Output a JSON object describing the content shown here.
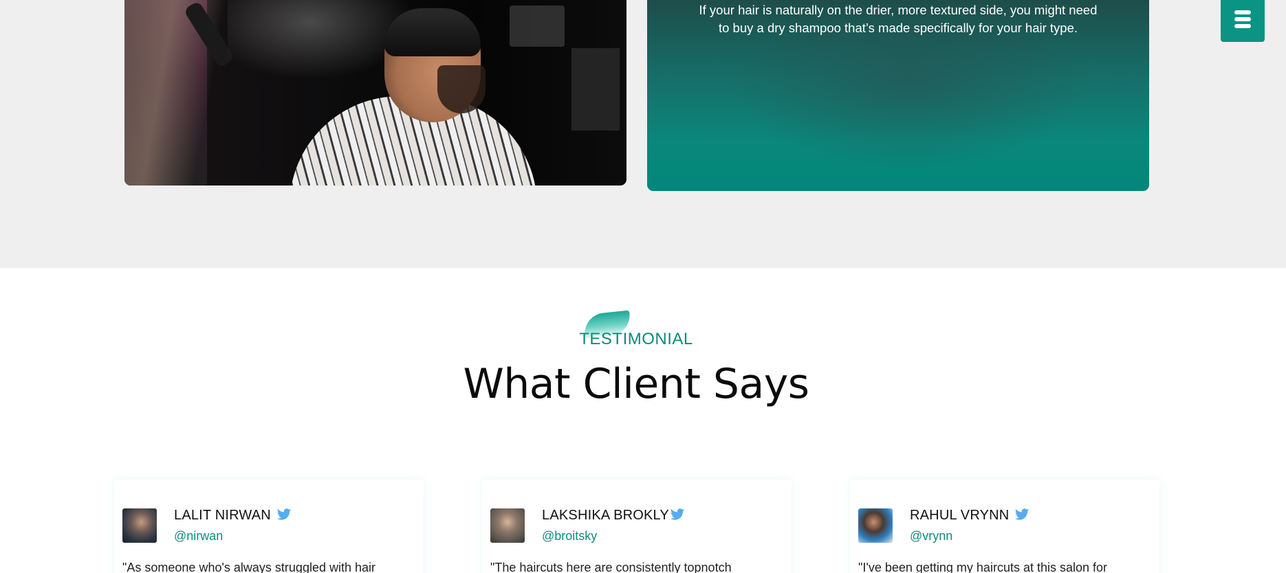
{
  "hero": {
    "tip_text": "If your hair is naturally on the drier, more textured side, you might need to buy a dry shampoo that’s made specifically for your hair type."
  },
  "menu": {
    "icon": "hamburger-menu-icon"
  },
  "testimonial": {
    "eyebrow": "TESTIMONIAL",
    "title": "What Client Says",
    "cards": [
      {
        "name": "LALIT NIRWAN",
        "handle": "@nirwan",
        "quote": "\"As someone who's always struggled with hair",
        "icon": "twitter-icon"
      },
      {
        "name": "LAKSHIKA BROKLY",
        "handle": "@broitsky",
        "quote": "\"The haircuts here are consistently topnotch",
        "icon": "twitter-icon"
      },
      {
        "name": "RAHUL VRYNN",
        "handle": "@vrynn",
        "quote": "\"I've been getting my haircuts at this salon for",
        "icon": "twitter-icon"
      }
    ]
  },
  "colors": {
    "accent": "#0b9384",
    "twitter": "#55acee",
    "band": "#efefef"
  }
}
